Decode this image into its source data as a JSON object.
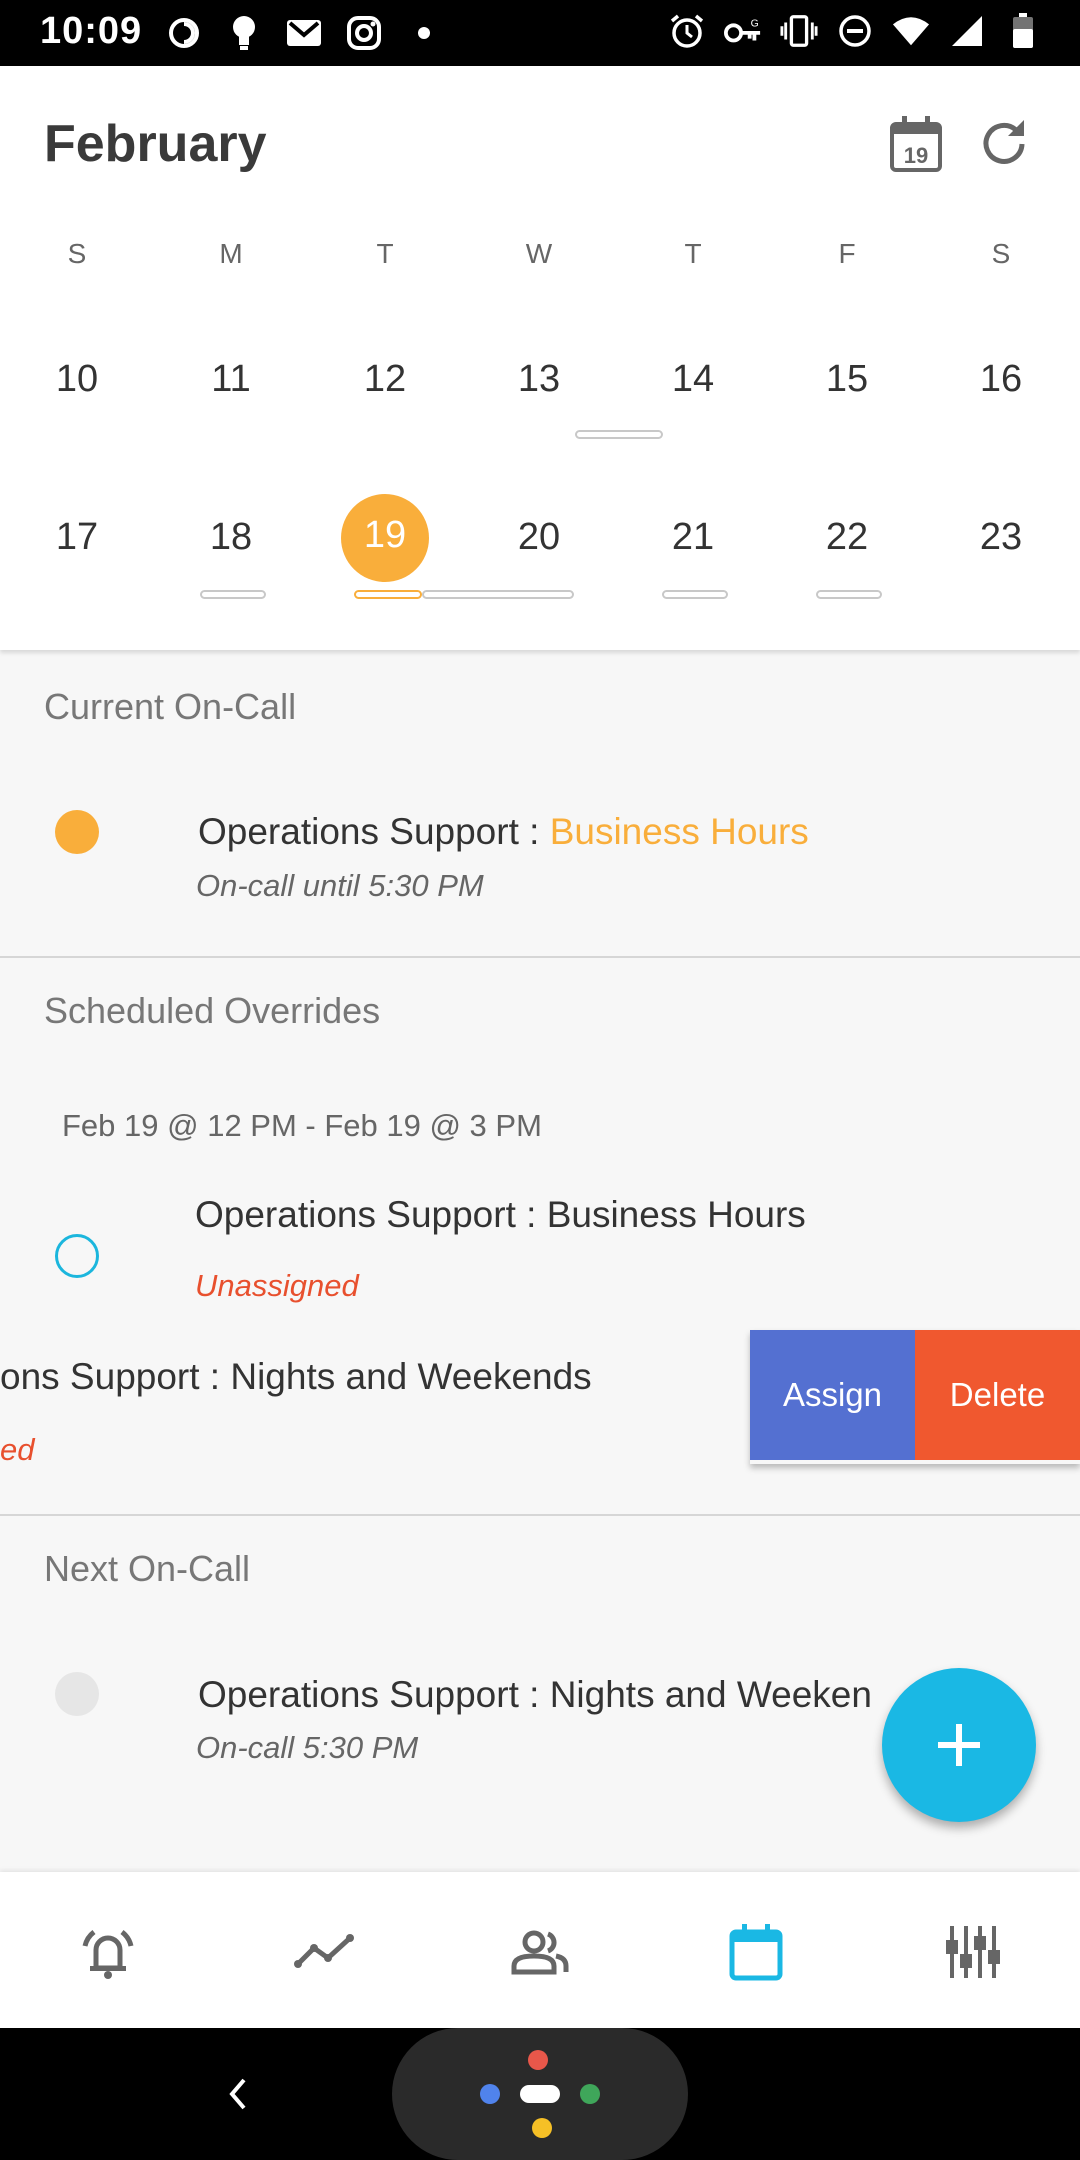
{
  "status_bar": {
    "time": "10:09",
    "left_icons": [
      "pushbullet-icon",
      "bulb-icon",
      "gmail-icon",
      "instagram-icon",
      "dot-icon"
    ],
    "right_icons": [
      "alarm-icon",
      "vpn-key-icon",
      "vibrate-icon",
      "dnd-icon",
      "wifi-icon",
      "signal-icon",
      "battery-icon"
    ]
  },
  "calendar": {
    "month": "February",
    "today_icon_label": "19",
    "weekdays": [
      "S",
      "M",
      "T",
      "W",
      "T",
      "F",
      "S"
    ],
    "week1": [
      "10",
      "11",
      "12",
      "13",
      "14",
      "15",
      "16"
    ],
    "week2": [
      "17",
      "18",
      "19",
      "20",
      "21",
      "22",
      "23"
    ],
    "selected_day": "19"
  },
  "current_oncall": {
    "title": "Current On-Call",
    "item": {
      "schedule": "Operations Support : ",
      "layer": "Business Hours",
      "subtitle": "On-call until 5:30 PM"
    }
  },
  "overrides": {
    "title": "Scheduled Overrides",
    "range": "Feb 19 @ 12 PM - Feb 19 @ 3 PM",
    "item1": {
      "title": "Operations Support : Business Hours",
      "status": "Unassigned"
    },
    "item2": {
      "title": "ons Support : Nights and Weekends",
      "status": "ed"
    },
    "assign_label": "Assign",
    "delete_label": "Delete"
  },
  "next_oncall": {
    "title": "Next On-Call",
    "item": {
      "title": "Operations Support : Nights and Weeken",
      "subtitle": "On-call 5:30 PM"
    }
  },
  "bottom_nav": [
    "alerts-icon",
    "analytics-icon",
    "teams-icon",
    "schedule-icon",
    "settings-icon"
  ],
  "colors": {
    "accent": "#f9ae3b",
    "primary": "#1ab8e4",
    "assign": "#5470d1",
    "delete": "#f0582f",
    "unassigned": "#e8502e"
  }
}
